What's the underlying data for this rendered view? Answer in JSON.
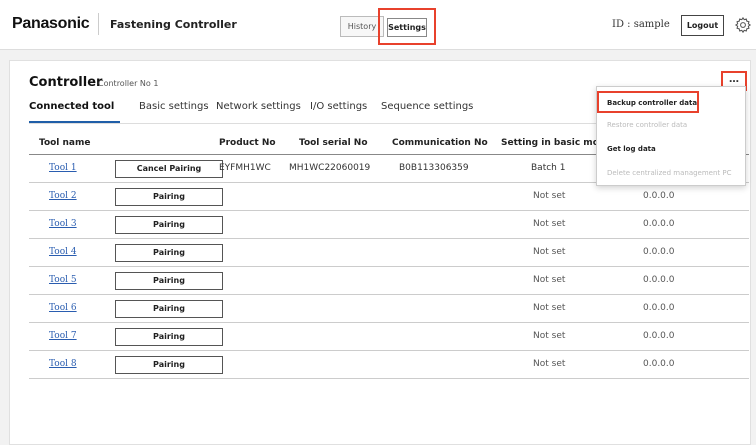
{
  "header": {
    "brand": "Panasonic",
    "app_title": "Fastening Controller",
    "tab_history": "History",
    "tab_settings": "Settings",
    "user_id": "ID : sample",
    "logout": "Logout"
  },
  "card": {
    "title": "Controller",
    "subtitle": "Controller No 1",
    "more": "…",
    "tabs": [
      "Connected tool",
      "Basic settings",
      "Network settings",
      "I/O settings",
      "Sequence settings"
    ]
  },
  "table": {
    "headers": [
      "Tool name",
      "Product No",
      "Tool serial No",
      "Communication No",
      "Setting in basic mode"
    ],
    "rows": [
      {
        "tool": "Tool 1",
        "button": "Cancel Pairing",
        "product": "EYFMH1WC",
        "serial": "MH1WC22060019",
        "comm": "B0B113306359",
        "basic": "Batch 1",
        "ip": ""
      },
      {
        "tool": "Tool 2",
        "button": "Pairing",
        "product": "",
        "serial": "",
        "comm": "",
        "basic": "Not set",
        "ip": "0.0.0.0"
      },
      {
        "tool": "Tool 3",
        "button": "Pairing",
        "product": "",
        "serial": "",
        "comm": "",
        "basic": "Not set",
        "ip": "0.0.0.0"
      },
      {
        "tool": "Tool 4",
        "button": "Pairing",
        "product": "",
        "serial": "",
        "comm": "",
        "basic": "Not set",
        "ip": "0.0.0.0"
      },
      {
        "tool": "Tool 5",
        "button": "Pairing",
        "product": "",
        "serial": "",
        "comm": "",
        "basic": "Not set",
        "ip": "0.0.0.0"
      },
      {
        "tool": "Tool 6",
        "button": "Pairing",
        "product": "",
        "serial": "",
        "comm": "",
        "basic": "Not set",
        "ip": "0.0.0.0"
      },
      {
        "tool": "Tool 7",
        "button": "Pairing",
        "product": "",
        "serial": "",
        "comm": "",
        "basic": "Not set",
        "ip": "0.0.0.0"
      },
      {
        "tool": "Tool 8",
        "button": "Pairing",
        "product": "",
        "serial": "",
        "comm": "",
        "basic": "Not set",
        "ip": "0.0.0.0"
      }
    ]
  },
  "menu": {
    "items": [
      {
        "label": "Backup controller data",
        "enabled": true
      },
      {
        "label": "Restore controller data",
        "enabled": false
      },
      {
        "label": "Get log data",
        "enabled": true
      },
      {
        "label": "Delete centralized management PC",
        "enabled": false
      }
    ]
  },
  "colors": {
    "highlight": "#e8412c",
    "link": "#2a5db0",
    "active_tab": "#1f5ea8"
  },
  "icons": {
    "settings": "gear-icon",
    "more": "more-options-icon"
  }
}
